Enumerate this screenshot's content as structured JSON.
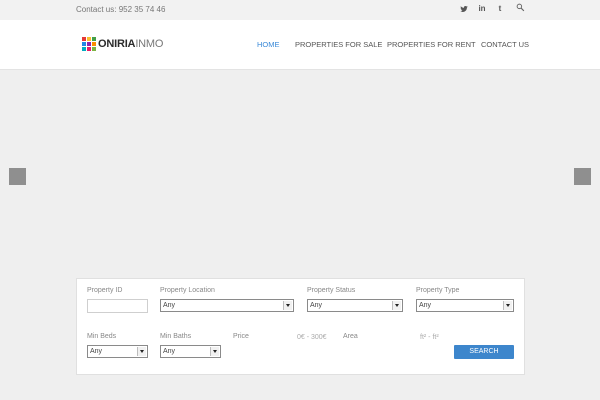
{
  "topbar": {
    "contact": "Contact us: 952 35 74 46",
    "social": {
      "twitter": "twitter-icon",
      "linkedin": "linkedin-icon",
      "tumblr": "tumblr-icon",
      "search": "search-icon"
    },
    "linkedin_glyph": "in",
    "tumblr_glyph": "t"
  },
  "header": {
    "logo": {
      "part1": "ONIRIA",
      "part2": "INMO"
    },
    "nav": [
      {
        "label": "HOME",
        "active": true
      },
      {
        "label": "PROPERTIES FOR SALE",
        "active": false
      },
      {
        "label": "PROPERTIES FOR RENT",
        "active": false
      },
      {
        "label": "CONTACT US",
        "active": false
      }
    ]
  },
  "search_form": {
    "property_id": {
      "label": "Property ID",
      "value": ""
    },
    "location": {
      "label": "Property Location",
      "value": "Any"
    },
    "status": {
      "label": "Property Status",
      "value": "Any"
    },
    "type": {
      "label": "Property Type",
      "value": "Any"
    },
    "min_beds": {
      "label": "Min Beds",
      "value": "Any"
    },
    "min_baths": {
      "label": "Min Baths",
      "value": "Any"
    },
    "price": {
      "label": "Price",
      "range": "0€ - 300€"
    },
    "area": {
      "label": "Area",
      "range": "ft² - ft²"
    },
    "search_button": "SEARCH"
  },
  "colors": {
    "accent": "#3b8ad8",
    "button": "#3d86cc",
    "arrow": "#8f8f8f"
  },
  "logo_colors": [
    "#e53935",
    "#fbc02d",
    "#43a047",
    "#1e88e5",
    "#8e24aa",
    "#fb8c00",
    "#00acc1",
    "#e91e63",
    "#7cb342"
  ]
}
